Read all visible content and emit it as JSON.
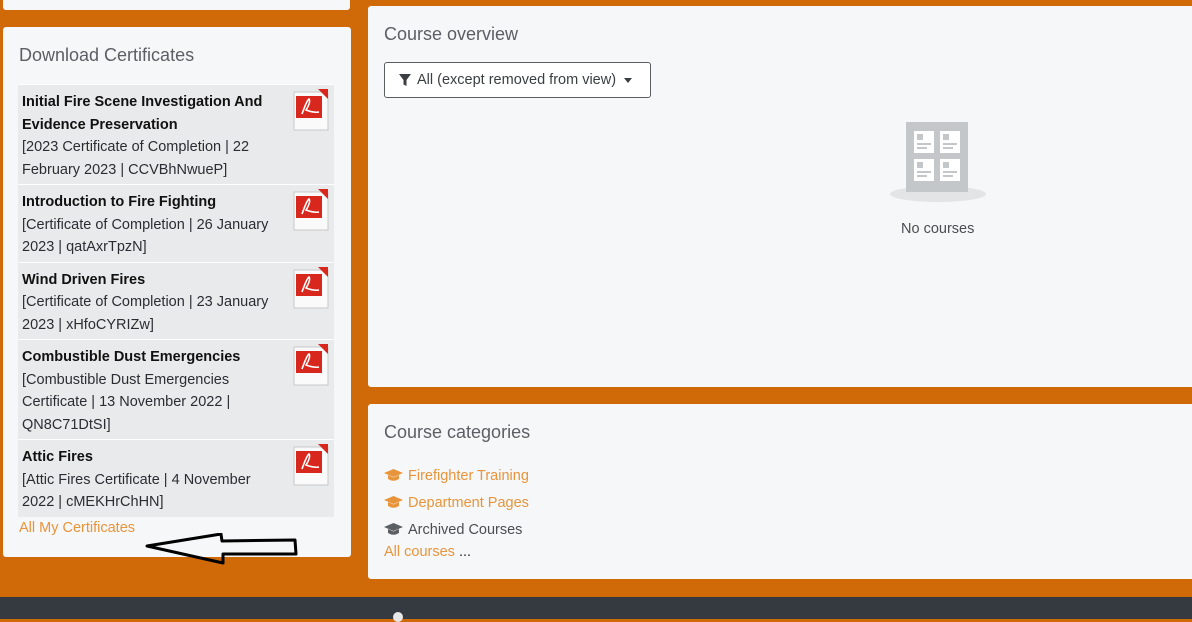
{
  "certificates": {
    "title": "Download Certificates",
    "items": [
      {
        "name": "Initial Fire Scene Investigation And Evidence Preservation",
        "meta": "[2023 Certificate of Completion | 22 February 2023 | CCVBhNwueP]"
      },
      {
        "name": "Introduction to Fire Fighting",
        "meta": "[Certificate of Completion | 26 January 2023 | qatAxrTpzN]"
      },
      {
        "name": "Wind Driven Fires",
        "meta": "[Certificate of Completion | 23 January 2023 | xHfoCYRIZw]"
      },
      {
        "name": "Combustible Dust Emergencies",
        "meta": "[Combustible Dust Emergencies Certificate | 13 November 2022 | QN8C71DtSI]"
      },
      {
        "name": "Attic Fires",
        "meta": "[Attic Fires Certificate | 4 November 2022 | cMEKHrChHN]"
      }
    ],
    "all_link": "All My Certificates"
  },
  "overview": {
    "title": "Course overview",
    "filter_label": "All (except removed from view)",
    "empty_text": "No courses"
  },
  "categories": {
    "title": "Course categories",
    "items": [
      {
        "label": "Firefighter Training"
      },
      {
        "label": "Department Pages"
      },
      {
        "label": "Archived Courses"
      }
    ],
    "all_link": "All courses",
    "all_suffix": " ..."
  },
  "colors": {
    "page_bg": "#d06a09",
    "link": "#e8943a",
    "footer": "#343a40"
  },
  "icons": [
    "pdf-icon",
    "filter-icon",
    "caret-down-icon",
    "graduation-cap-icon",
    "arrow-annotation-icon"
  ]
}
